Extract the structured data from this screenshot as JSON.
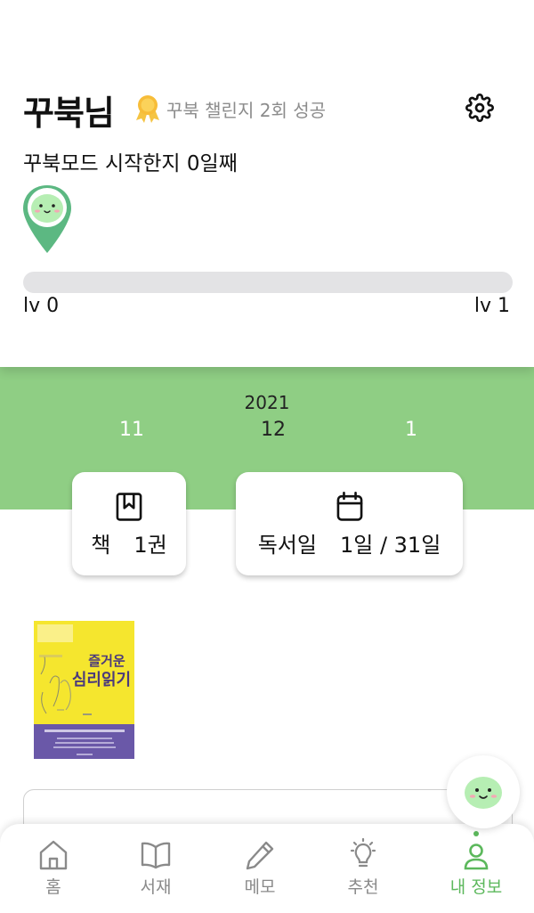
{
  "profile": {
    "name": "꾸북님",
    "badge_text": "꾸북 챌린지 2회 성공",
    "mode_text": "꾸북모드 시작한지 0일째",
    "progress": 0,
    "level_start": "lv 0",
    "level_end": "lv 1"
  },
  "calendar": {
    "year": "2021",
    "prev_month": "11",
    "current_month": "12",
    "next_month": "1"
  },
  "stats": {
    "books_label": "책",
    "books_value": "1권",
    "days_label": "독서일",
    "days_value": "1일 / 31일"
  },
  "book": {
    "cover_title_line1": "즐거운",
    "cover_title_line2": "심리읽기"
  },
  "nav": [
    {
      "label": "홈",
      "icon": "home-icon"
    },
    {
      "label": "서재",
      "icon": "book-open-icon"
    },
    {
      "label": "메모",
      "icon": "pencil-icon"
    },
    {
      "label": "추천",
      "icon": "lightbulb-icon"
    },
    {
      "label": "내 정보",
      "icon": "user-icon",
      "active": true
    }
  ],
  "colors": {
    "accent": "#8fce84",
    "active": "#5cb85c",
    "turtle": "#b6eeb3"
  }
}
